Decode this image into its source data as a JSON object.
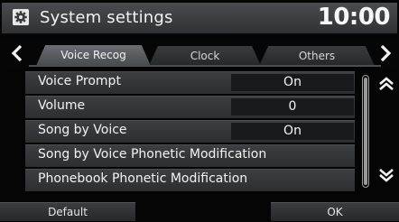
{
  "header": {
    "title": "System settings",
    "clock": "10:00",
    "icon": "gear-icon"
  },
  "tabs": [
    {
      "label": "Voice Recog",
      "active": true
    },
    {
      "label": "Clock",
      "active": false
    },
    {
      "label": "Others",
      "active": false
    }
  ],
  "list": {
    "items": [
      {
        "label": "Voice Prompt",
        "value": "On"
      },
      {
        "label": "Volume",
        "value": "0"
      },
      {
        "label": "Song by Voice",
        "value": "On"
      },
      {
        "label": "Song by Voice Phonetic Modification"
      },
      {
        "label": "Phonebook Phonetic Modification"
      }
    ]
  },
  "buttons": {
    "default_label": "Default",
    "ok_label": "OK"
  },
  "colors": {
    "background": "#050505",
    "row": "#35373a",
    "value_box": "#181a1b",
    "text": "#f3f3f3"
  }
}
